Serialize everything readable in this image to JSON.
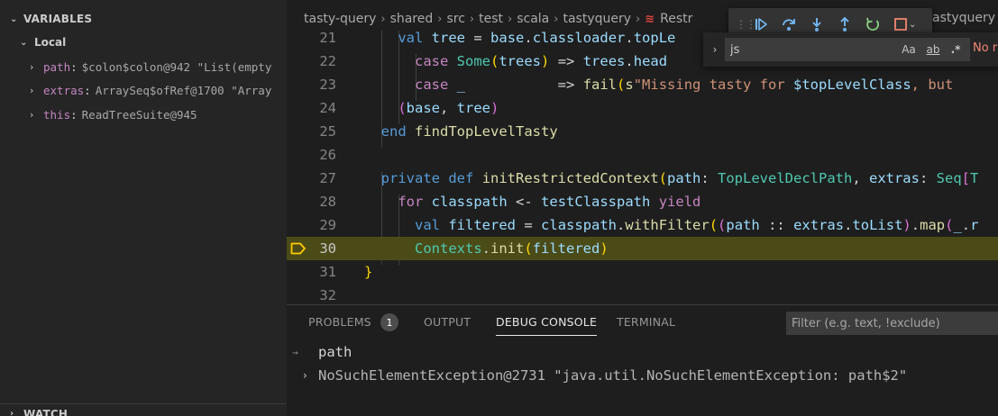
{
  "sidebar": {
    "variables_title": "VARIABLES",
    "scope_label": "Local",
    "variables": [
      {
        "name": "path",
        "value": "$colon$colon@942 \"List(empty"
      },
      {
        "name": "extras",
        "value": "ArraySeq$ofRef@1700 \"Array"
      },
      {
        "name": "this",
        "value": "ReadTreeSuite@945"
      }
    ],
    "watch_title": "WATCH"
  },
  "breadcrumb": [
    "tasty-query",
    "shared",
    "src",
    "test",
    "scala",
    "tastyquery",
    "Restr",
    "astyquery"
  ],
  "debug_toolbar": {
    "buttons": [
      "continue-icon",
      "step-over-icon",
      "step-into-icon",
      "step-out-icon",
      "restart-icon",
      "stop-icon"
    ]
  },
  "find_widget": {
    "query": "js",
    "match_case": "Aa",
    "whole_word": "ab",
    "regex": ".*",
    "result": "No r"
  },
  "editor": {
    "current_line": 30,
    "lines": [
      {
        "number": "21",
        "text": "    val tree = base.classloader.topLe"
      },
      {
        "number": "22",
        "text": "      case Some(trees) => trees.head"
      },
      {
        "number": "23",
        "text": "      case _           => fail(s\"Missing tasty for $topLevelClass, but"
      },
      {
        "number": "24",
        "text": "    (base, tree)"
      },
      {
        "number": "25",
        "text": "  end findTopLevelTasty"
      },
      {
        "number": "26",
        "text": ""
      },
      {
        "number": "27",
        "text": "  private def initRestrictedContext(path: TopLevelDeclPath, extras: Seq[T"
      },
      {
        "number": "28",
        "text": "    for classpath <- testClasspath yield"
      },
      {
        "number": "29",
        "text": "      val filtered = classpath.withFilter((path :: extras.toList).map(_.r"
      },
      {
        "number": "30",
        "text": "      Contexts.init(filtered)"
      },
      {
        "number": "31",
        "text": "}"
      },
      {
        "number": "32",
        "text": ""
      }
    ]
  },
  "panel": {
    "tabs": [
      {
        "label": "PROBLEMS",
        "badge": "1"
      },
      {
        "label": "OUTPUT"
      },
      {
        "label": "DEBUG CONSOLE"
      },
      {
        "label": "TERMINAL"
      }
    ],
    "active_tab": "DEBUG CONSOLE",
    "filter_placeholder": "Filter (e.g. text, !exclude)",
    "console": {
      "input": "path",
      "output": "NoSuchElementException@2731 \"java.util.NoSuchElementException: path$2\""
    }
  },
  "colors": {
    "current_line_highlight": "#4b4b18",
    "breakpoint_arrow": "#ffcc00",
    "debug_continue": "#75beff",
    "debug_restart": "#89d185",
    "debug_stop": "#f48771"
  }
}
